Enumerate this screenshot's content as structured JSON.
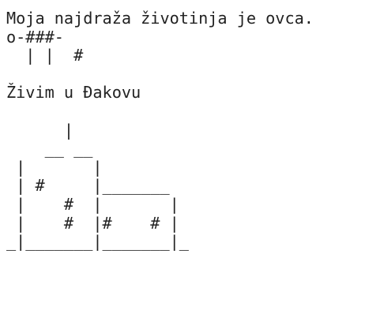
{
  "document": {
    "lines": [
      "Moja najdraža životinja je ovca.",
      "o-###-",
      "  | |  #",
      "",
      "Živim u Đakovu",
      "",
      "      |",
      "    __ __",
      " |       |",
      " | #     |_______",
      " |    #  |       |",
      " |    #  |#    # |",
      "_|_______|_______|_"
    ]
  }
}
